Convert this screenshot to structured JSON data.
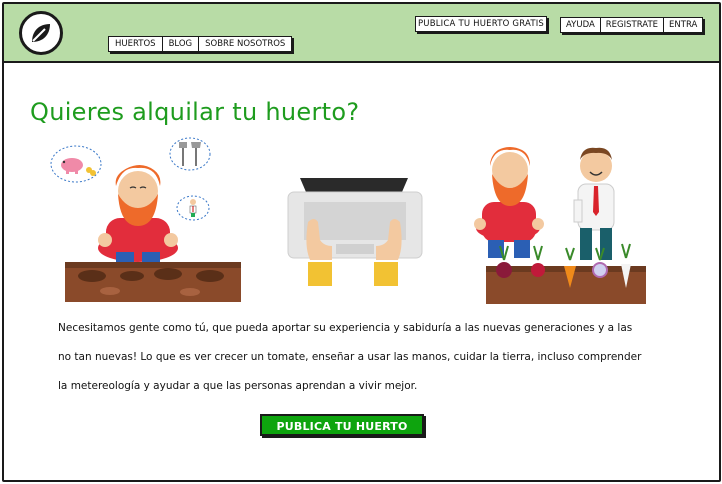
{
  "header": {
    "publish_free": "PUBLICA TU HUERTO GRATIS",
    "nav": [
      "HUERTOS",
      "BLOG",
      "SOBRE NOSOTROS"
    ],
    "auth": [
      "AYUDA",
      "REGISTRATE",
      "ENTRA"
    ]
  },
  "main": {
    "title": "Quieres alquilar tu huerto?",
    "paragraph_lines": [
      "Necesitamos gente como tú, que pueda aportar su experiencia y sabiduría a las nuevas generaciones y a las",
      "no tan nuevas! Lo que es ver crecer un tomate, enseñar a usar las manos, cuidar la tierra, incluso comprender",
      "la metereología y ayudar a que las personas aprendan a vivir mejor."
    ],
    "cta_label": "PUBLICA TU HUERTO"
  },
  "colors": {
    "header_bg": "#b8dca6",
    "title_green": "#1e9c1e",
    "cta_green": "#0ea40e",
    "soil": "#8a4a2a"
  },
  "icons": [
    "leaf-icon",
    "piggy-bank-icon",
    "tools-icon",
    "person-icon",
    "laptop-icon",
    "hands-icon",
    "vegetables-icon"
  ]
}
